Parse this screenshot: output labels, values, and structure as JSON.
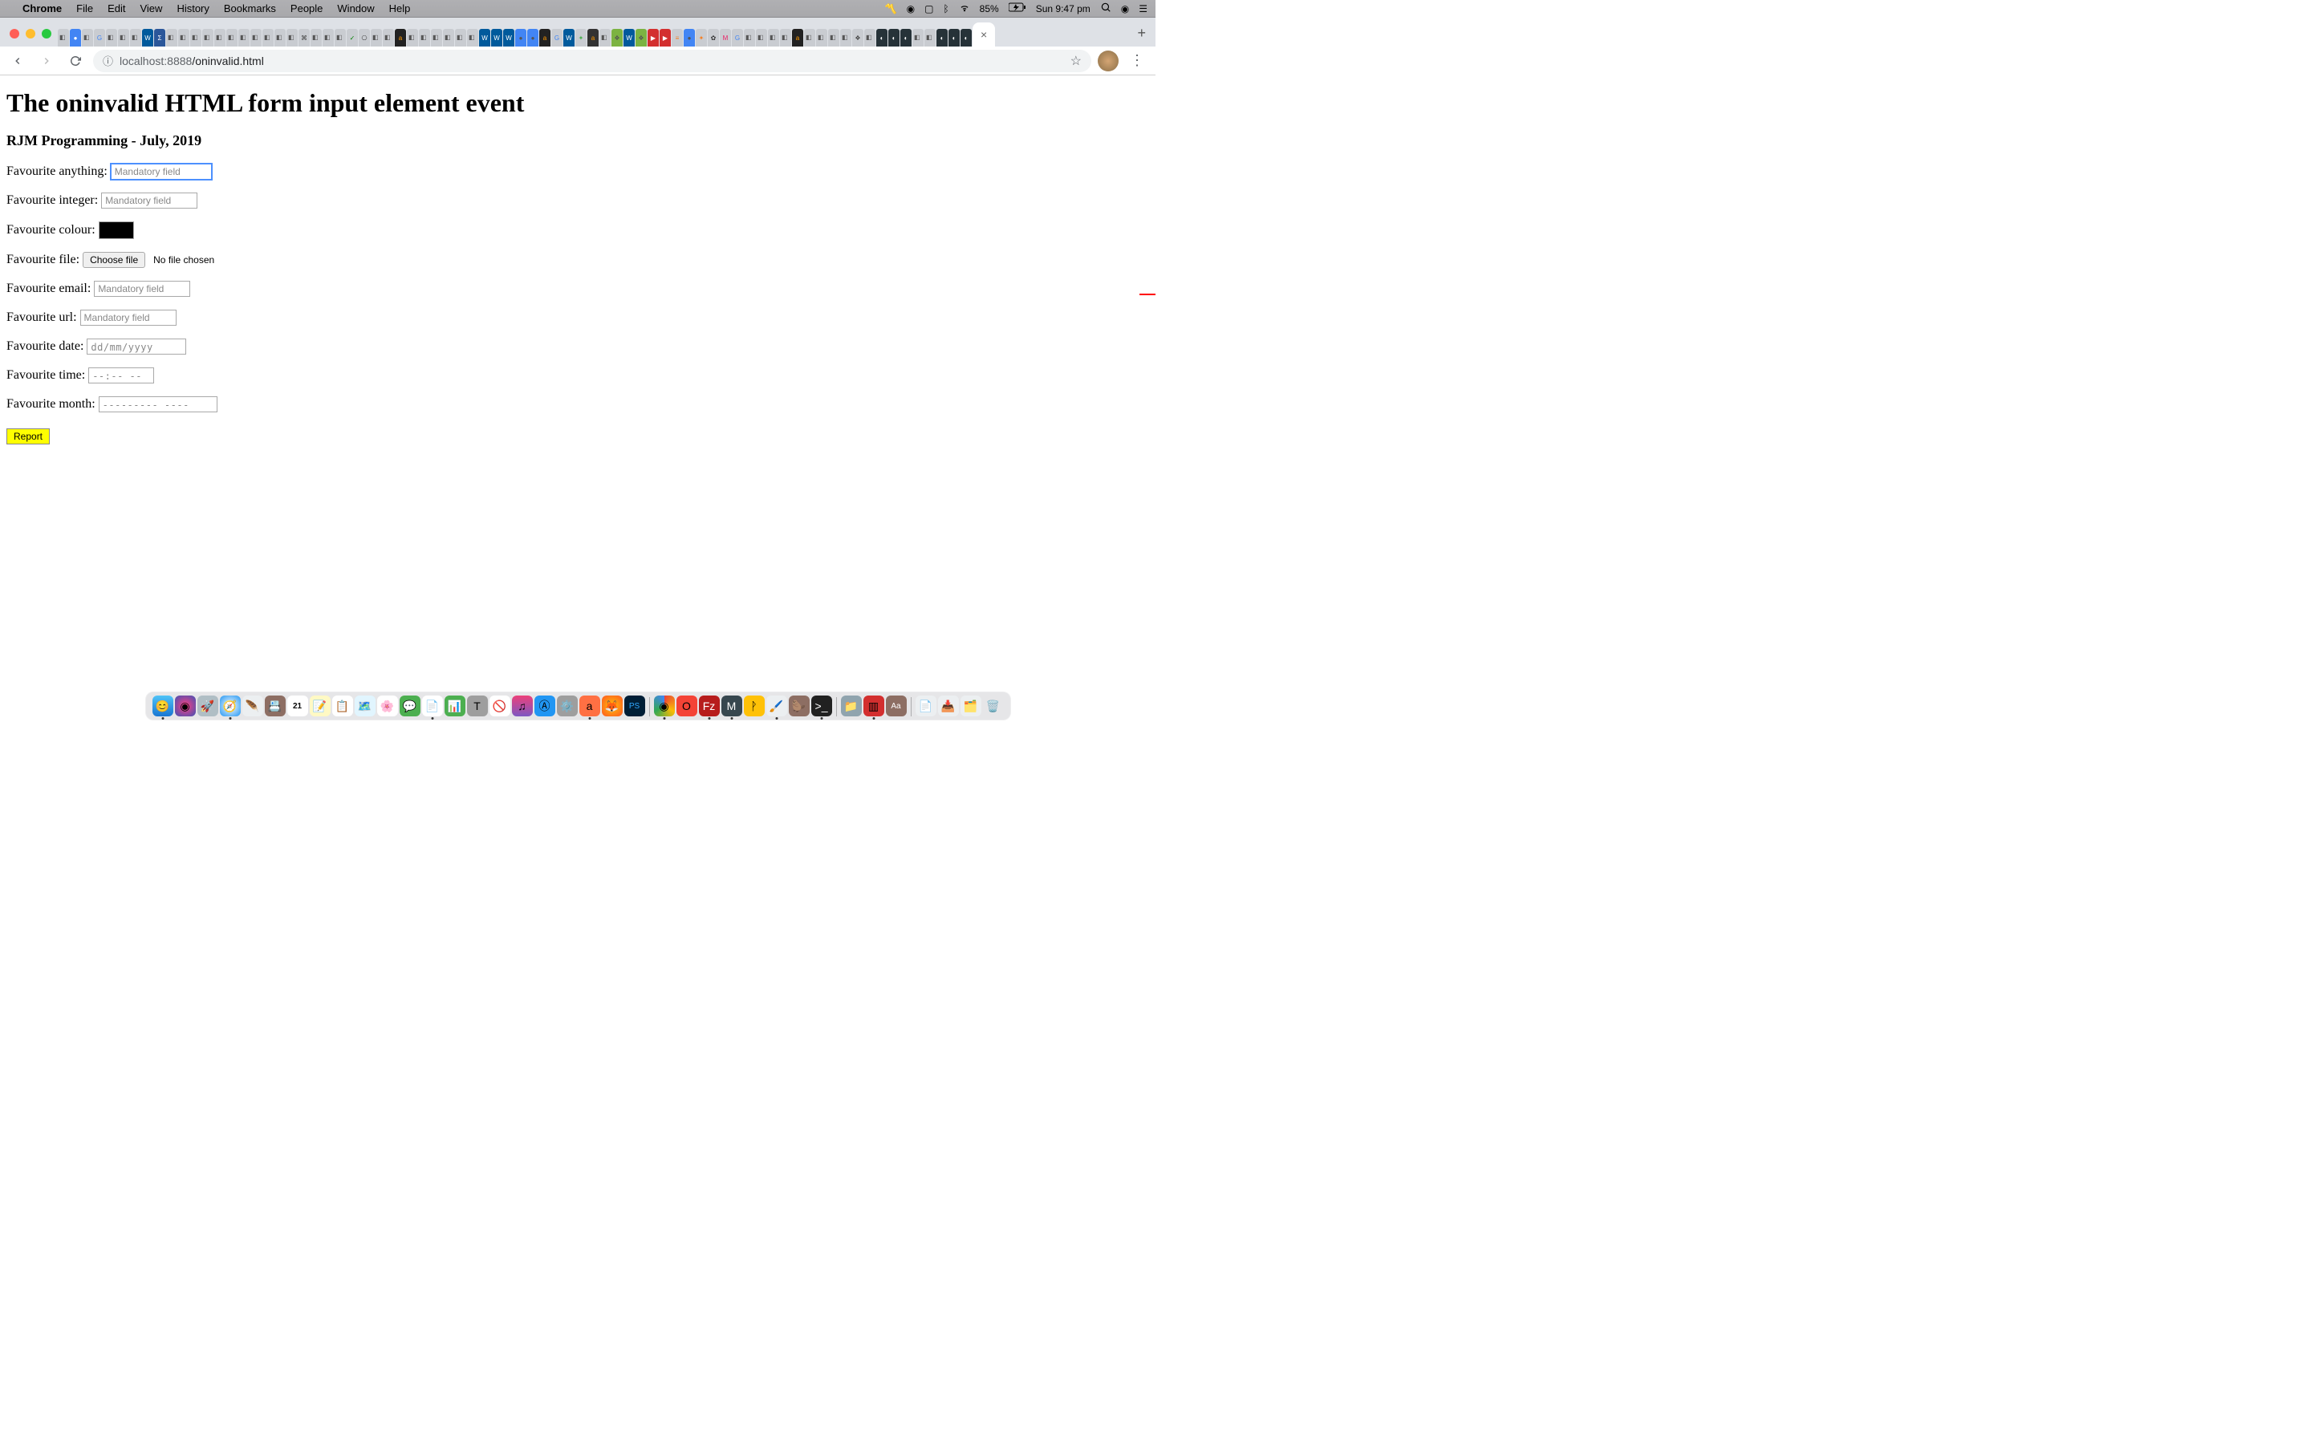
{
  "menubar": {
    "app": "Chrome",
    "items": [
      "File",
      "Edit",
      "View",
      "History",
      "Bookmarks",
      "People",
      "Window",
      "Help"
    ],
    "battery": "85%",
    "clock": "Sun 9:47 pm"
  },
  "toolbar": {
    "url_prefix": "localhost",
    "url_port": ":8888",
    "url_path": "/oninvalid.html"
  },
  "page": {
    "h1": "The oninvalid HTML form input element event",
    "h3": "RJM Programming - July, 2019",
    "labels": {
      "anything": "Favourite anything:",
      "integer": "Favourite integer:",
      "colour": "Favourite colour:",
      "file": "Favourite file:",
      "email": "Favourite email:",
      "url": "Favourite url:",
      "date": "Favourite date:",
      "time": "Favourite time:",
      "month": "Favourite month:"
    },
    "placeholders": {
      "mandatory": "Mandatory field",
      "date": "dd/mm/yyyy",
      "time": "--:-- --",
      "month": "--------- ----"
    },
    "file_button": "Choose file",
    "file_status": "No file chosen",
    "submit": "Report",
    "color_value": "#000000"
  }
}
